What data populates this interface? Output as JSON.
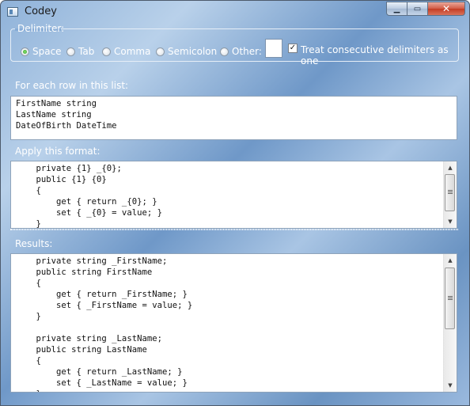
{
  "window": {
    "title": "Codey",
    "minimize_symbol": "▁",
    "maximize_symbol": "▭",
    "close_symbol": "✕"
  },
  "delimiter": {
    "legend": "Delimiter:",
    "options": [
      {
        "label": "Space",
        "selected": true
      },
      {
        "label": "Tab",
        "selected": false
      },
      {
        "label": "Comma",
        "selected": false
      },
      {
        "label": "Semicolon",
        "selected": false
      },
      {
        "label": "Other:",
        "selected": false
      }
    ],
    "other_value": "",
    "treat_consecutive": {
      "label": "Treat consecutive delimiters as one",
      "checked": true,
      "check_mark": "✓"
    }
  },
  "rows_section": {
    "label": "For each row in this list:",
    "text": "FirstName string\nLastName string\nDateOfBirth DateTime"
  },
  "format_section": {
    "label": "Apply this format:",
    "text": "    private {1} _{0};\n    public {1} {0}\n    {\n        get { return _{0}; }\n        set { _{0} = value; }\n    }"
  },
  "results_section": {
    "label": "Results:",
    "text": "    private string _FirstName;\n    public string FirstName\n    {\n        get { return _FirstName; }\n        set { _FirstName = value; }\n    }\n\n    private string _LastName;\n    public string LastName\n    {\n        get { return _LastName; }\n        set { _LastName = value; }\n    }"
  },
  "scroll": {
    "up_arrow": "▲",
    "down_arrow": "▼"
  }
}
